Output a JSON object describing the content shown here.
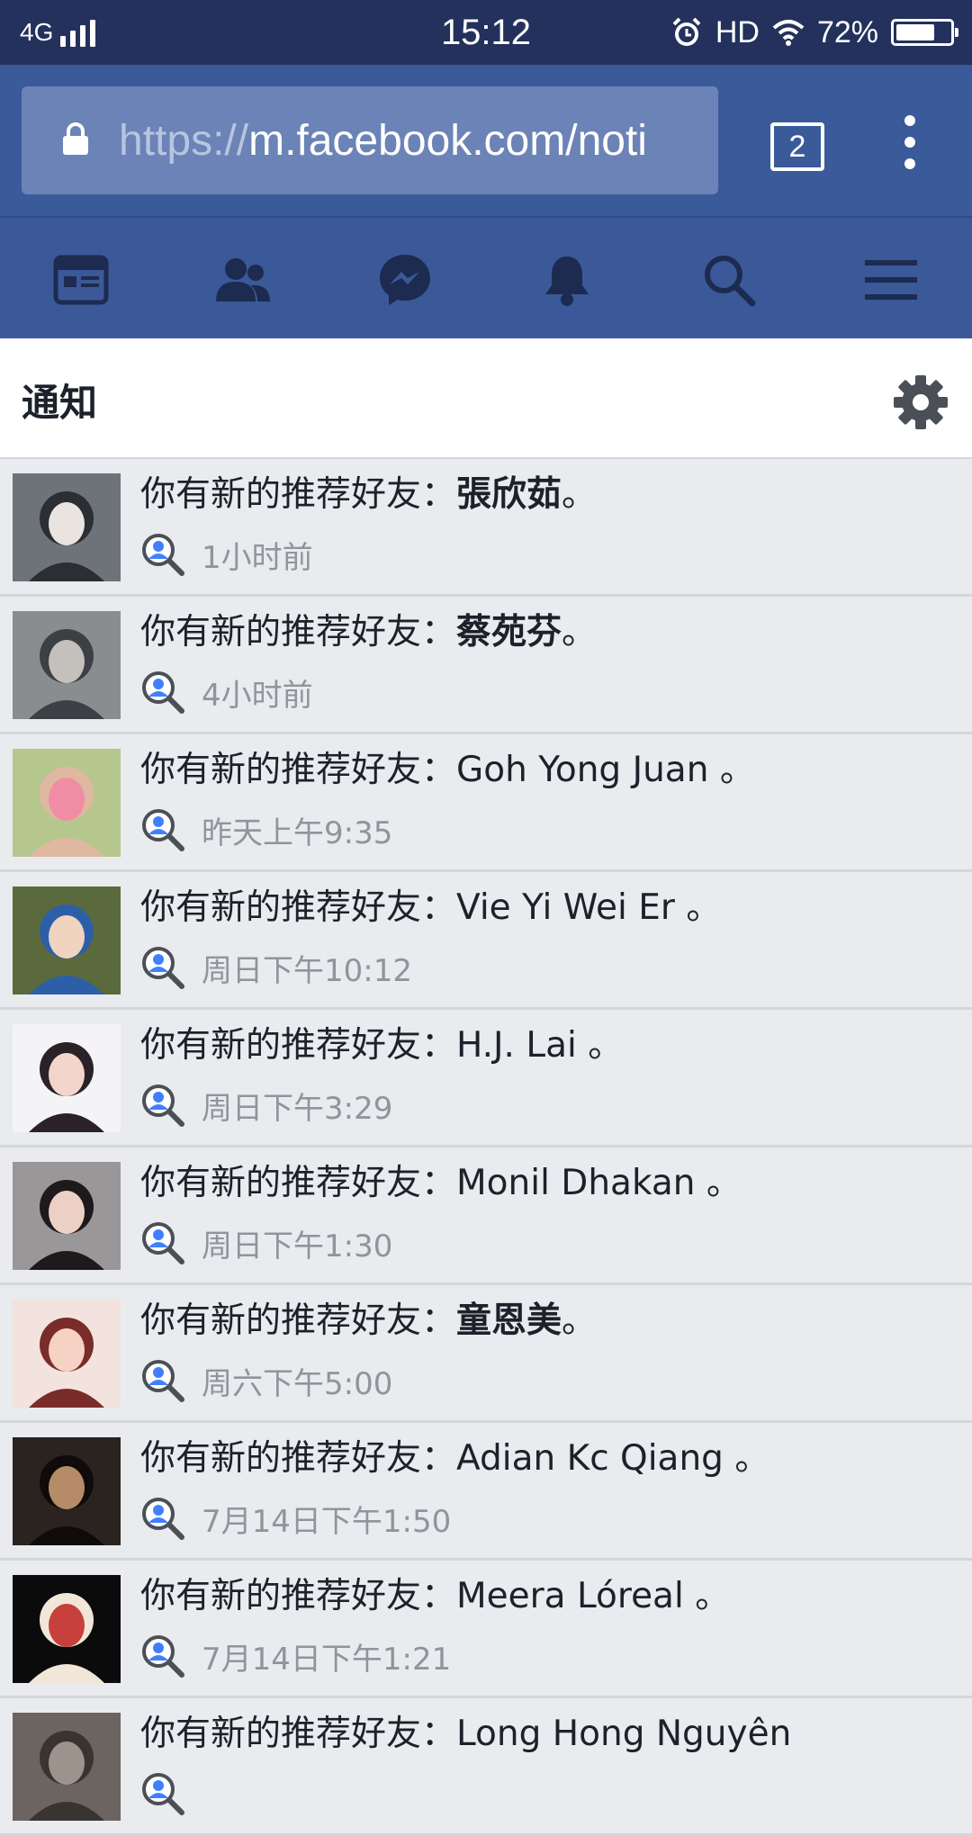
{
  "status_bar": {
    "network": "4G",
    "time": "15:12",
    "hd": "HD",
    "battery": "72%",
    "battery_level": 0.72
  },
  "browser": {
    "url_prefix": "https://",
    "url_rest": "m.facebook.com/noti",
    "tab_count": "2"
  },
  "nav": {
    "icons": [
      "news-feed-icon",
      "friends-icon",
      "messenger-icon",
      "notifications-bell-icon",
      "search-icon",
      "menu-icon"
    ]
  },
  "page": {
    "title": "通知"
  },
  "notifications": [
    {
      "prefix": "你有新的推荐好友：",
      "name": "張欣茹",
      "suffix": "。",
      "time": "1小时前",
      "cjk": true,
      "avatar_colors": [
        "#6d7378",
        "#2b2f33",
        "#e9e4df"
      ]
    },
    {
      "prefix": "你有新的推荐好友：",
      "name": "蔡苑芬",
      "suffix": "。",
      "time": "4小时前",
      "cjk": true,
      "avatar_colors": [
        "#8a8d90",
        "#3c3f43",
        "#c4c0bc"
      ]
    },
    {
      "prefix": "你有新的推荐好友：",
      "name": "Goh Yong Juan",
      "suffix": " 。",
      "time": "昨天上午9:35",
      "cjk": false,
      "avatar_colors": [
        "#b6c78e",
        "#e0b7a0",
        "#f08da4"
      ]
    },
    {
      "prefix": "你有新的推荐好友：",
      "name": "Vie Yi Wei Er",
      "suffix": " 。",
      "time": "周日下午10:12",
      "cjk": false,
      "avatar_colors": [
        "#5b6a3c",
        "#2d5fa8",
        "#f0d4c0"
      ]
    },
    {
      "prefix": "你有新的推荐好友：",
      "name": "H.J. Lai",
      "suffix": " 。",
      "time": "周日下午3:29",
      "cjk": false,
      "avatar_colors": [
        "#f4f4f6",
        "#2a2227",
        "#f3d5cc"
      ]
    },
    {
      "prefix": "你有新的推荐好友：",
      "name": "Monil Dhakan",
      "suffix": " 。",
      "time": "周日下午1:30",
      "cjk": false,
      "avatar_colors": [
        "#9a9798",
        "#1e1a1b",
        "#ecd0c6"
      ]
    },
    {
      "prefix": "你有新的推荐好友：",
      "name": "童恩美",
      "suffix": "。",
      "time": "周六下午5:00",
      "cjk": true,
      "avatar_colors": [
        "#f3e3de",
        "#7a2c2a",
        "#f6d2c4"
      ]
    },
    {
      "prefix": "你有新的推荐好友：",
      "name": "Adian Kc Qiang",
      "suffix": " 。",
      "time": "7月14日下午1:50",
      "cjk": false,
      "avatar_colors": [
        "#2a2320",
        "#0e0b0a",
        "#b58c67"
      ]
    },
    {
      "prefix": "你有新的推荐好友：",
      "name": "Meera Lóreal",
      "suffix": " 。",
      "time": "7月14日下午1:21",
      "cjk": false,
      "avatar_colors": [
        "#0b0b0b",
        "#f1e6d8",
        "#c7403c"
      ]
    },
    {
      "prefix": "你有新的推荐好友：",
      "name": "Long Hong Nguyên",
      "suffix": "",
      "time": "",
      "cjk": false,
      "avatar_colors": [
        "#6b6460",
        "#3a3431",
        "#9c938d"
      ]
    }
  ]
}
